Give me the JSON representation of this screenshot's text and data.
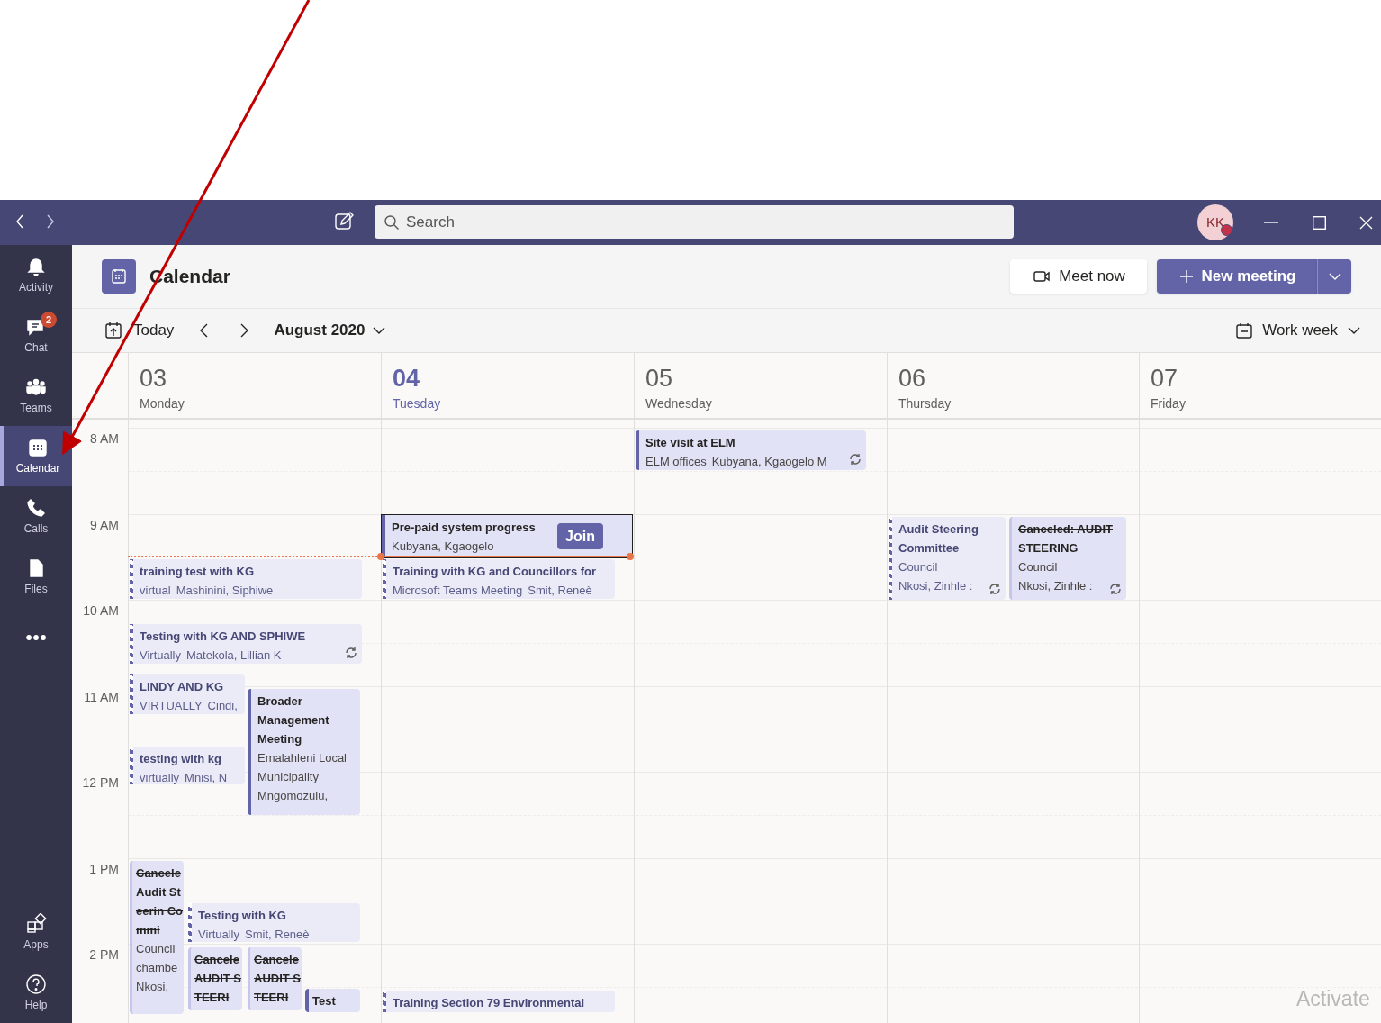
{
  "annotation": {
    "kind": "arrow"
  },
  "title_bar": {
    "search": {
      "placeholder": "Search"
    },
    "avatar": {
      "initials": "KK"
    }
  },
  "sidebar": {
    "items": [
      {
        "label": "Activity",
        "selected": false
      },
      {
        "label": "Chat",
        "selected": false,
        "badge": "2"
      },
      {
        "label": "Teams",
        "selected": false
      },
      {
        "label": "Calendar",
        "selected": true
      },
      {
        "label": "Calls",
        "selected": false
      },
      {
        "label": "Files",
        "selected": false
      },
      {
        "selected": false
      }
    ],
    "bottom_items": [
      {
        "label": "Apps",
        "selected": false
      },
      {
        "label": "Help",
        "selected": false
      }
    ]
  },
  "header": {
    "title": "Calendar",
    "meet_now": "Meet now",
    "new_meeting": "New meeting"
  },
  "toolbar": {
    "today": "Today",
    "month": "August 2020",
    "view": "Work week"
  },
  "time_labels": [
    "8 AM",
    "9 AM",
    "10 AM",
    "11 AM",
    "12 PM",
    "1 PM",
    "2 PM"
  ],
  "days": [
    {
      "number": "03",
      "name": "Monday",
      "selected": false,
      "events": [
        {
          "kind": "tentative",
          "title": "training test with KG",
          "details": [
            "virtual",
            "Mashinini, Siphiwe"
          ],
          "recurring": false
        },
        {
          "kind": "tentative",
          "title": "Testing with KG AND SPHIWE",
          "details": [
            "Virtually",
            "Matekola, Lillian K"
          ],
          "recurring": true
        },
        {
          "kind": "tentative",
          "title": "LINDY AND KG",
          "details": [
            "VIRTUALLY",
            "Cindi,"
          ],
          "recurring": false
        },
        {
          "kind": "tentative",
          "title": "testing with kg",
          "details": [
            "virtually",
            "Mnisi, N"
          ],
          "recurring": false
        },
        {
          "kind": "busy",
          "title": "Broader Management Meeting",
          "details": [
            "Emalahleni Local Municipality",
            "Mngomozulu,"
          ],
          "recurring": false
        },
        {
          "kind": "canceled",
          "title": "Cancele Audit Steerin Commi",
          "details": [
            "Council chambe",
            "Nkosi,"
          ],
          "recurring": false
        },
        {
          "kind": "tentative",
          "title": "Testing with KG",
          "details": [
            "Virtually",
            "Smit, Reneè"
          ],
          "recurring": false
        },
        {
          "kind": "canceled",
          "title": "Cancele AUDIT STEERI",
          "recurring": false
        },
        {
          "kind": "canceled",
          "title": "Cancele AUDIT STEERI",
          "recurring": false
        },
        {
          "kind": "busy",
          "title": "Test",
          "recurring": false
        }
      ]
    },
    {
      "number": "04",
      "name": "Tuesday",
      "selected": true,
      "events": [
        {
          "kind": "busy",
          "title": "Pre-paid system progress",
          "details": [
            "Kubyana, Kgaogelo"
          ],
          "recurring": false,
          "selected": true,
          "join": "Join"
        },
        {
          "kind": "tentative",
          "title": "Training with KG and Councillors for",
          "details": [
            "Microsoft Teams Meeting",
            "Smit, Reneè"
          ],
          "recurring": false
        },
        {
          "kind": "tentative",
          "title": "Training Section 79 Environmental",
          "recurring": false
        }
      ]
    },
    {
      "number": "05",
      "name": "Wednesday",
      "selected": false,
      "events": [
        {
          "kind": "busy",
          "title": "Site visit at ELM",
          "details": [
            "ELM offices",
            "Kubyana, Kgaogelo M"
          ],
          "recurring": true
        }
      ]
    },
    {
      "number": "06",
      "name": "Thursday",
      "selected": false,
      "events": [
        {
          "kind": "tentative",
          "title": "Audit Steering Committee",
          "details": [
            "Council",
            "Nkosi, Zinhle :"
          ],
          "recurring": true
        },
        {
          "kind": "canceled",
          "title": "Canceled: AUDIT STEERING",
          "details": [
            "Council",
            "Nkosi, Zinhle :"
          ],
          "recurring": true
        }
      ]
    },
    {
      "number": "07",
      "name": "Friday",
      "selected": false
    }
  ],
  "watermark_text": "Activate"
}
